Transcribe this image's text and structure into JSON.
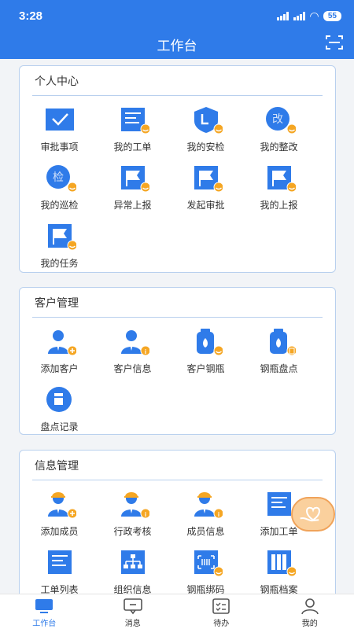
{
  "status": {
    "time": "3:28",
    "battery": "55"
  },
  "header": {
    "title": "工作台"
  },
  "sections": [
    {
      "title": "个人中心",
      "items": [
        {
          "label": "审批事项",
          "icon": "check-monitor-icon"
        },
        {
          "label": "我的工单",
          "icon": "document-list-icon"
        },
        {
          "label": "我的安检",
          "icon": "shield-icon"
        },
        {
          "label": "我的整改",
          "icon": "rectify-icon",
          "glyph": "改"
        },
        {
          "label": "我的巡检",
          "icon": "inspect-icon",
          "glyph": "检"
        },
        {
          "label": "异常上报",
          "icon": "flag-icon"
        },
        {
          "label": "发起审批",
          "icon": "flag-icon"
        },
        {
          "label": "我的上报",
          "icon": "flag-icon"
        },
        {
          "label": "我的任务",
          "icon": "flag-icon"
        }
      ]
    },
    {
      "title": "客户管理",
      "items": [
        {
          "label": "添加客户",
          "icon": "add-customer-icon"
        },
        {
          "label": "客户信息",
          "icon": "customer-info-icon"
        },
        {
          "label": "客户钢瓶",
          "icon": "gas-cylinder-icon"
        },
        {
          "label": "钢瓶盘点",
          "icon": "cylinder-inventory-icon"
        },
        {
          "label": "盘点记录",
          "icon": "inventory-record-icon"
        }
      ]
    },
    {
      "title": "信息管理",
      "items": [
        {
          "label": "添加成员",
          "icon": "add-member-icon"
        },
        {
          "label": "行政考核",
          "icon": "assessment-icon"
        },
        {
          "label": "成员信息",
          "icon": "member-info-icon"
        },
        {
          "label": "添加工单",
          "icon": "add-work-order-icon"
        },
        {
          "label": "工单列表",
          "icon": "work-order-list-icon"
        },
        {
          "label": "组织信息",
          "icon": "org-chart-icon"
        },
        {
          "label": "钢瓶绑码",
          "icon": "cylinder-bind-code-icon"
        },
        {
          "label": "钢瓶档案",
          "icon": "cylinder-archive-icon"
        }
      ]
    }
  ],
  "tabs": [
    {
      "label": "工作台",
      "icon": "monitor-icon",
      "active": true
    },
    {
      "label": "消息",
      "icon": "message-icon",
      "active": false
    },
    {
      "label": "待办",
      "icon": "todo-icon",
      "active": false
    },
    {
      "label": "我的",
      "icon": "user-icon",
      "active": false
    }
  ],
  "colors": {
    "primary": "#2f7be9",
    "badge": "#f5a623",
    "border": "#b9d0ee"
  }
}
